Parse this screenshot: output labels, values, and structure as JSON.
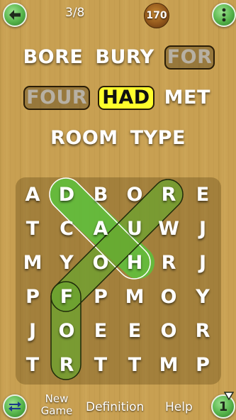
{
  "header": {
    "back_icon": "arrow-left-icon",
    "progress": "3/8",
    "score": "170",
    "menu_icon": "vertical-dots-icon"
  },
  "words": {
    "rows": [
      [
        {
          "text": "BORE",
          "state": "normal"
        },
        {
          "text": "BURY",
          "state": "normal"
        },
        {
          "text": "FOR",
          "state": "found"
        }
      ],
      [
        {
          "text": "FOUR",
          "state": "found"
        },
        {
          "text": "HAD",
          "state": "highlight"
        },
        {
          "text": "MET",
          "state": "normal"
        }
      ],
      [
        {
          "text": "ROOM",
          "state": "normal"
        },
        {
          "text": "TYPE",
          "state": "normal"
        }
      ]
    ]
  },
  "grid": {
    "letters": [
      [
        "A",
        "D",
        "B",
        "O",
        "R",
        "E"
      ],
      [
        "T",
        "C",
        "A",
        "U",
        "W",
        "J"
      ],
      [
        "M",
        "Y",
        "O",
        "H",
        "R",
        "J"
      ],
      [
        "P",
        "F",
        "P",
        "M",
        "O",
        "Y"
      ],
      [
        "J",
        "O",
        "E",
        "E",
        "O",
        "R"
      ],
      [
        "T",
        "R",
        "T",
        "T",
        "M",
        "P"
      ]
    ],
    "selections": [
      {
        "word": "HAD",
        "from": [
          2,
          3
        ],
        "to": [
          0,
          1
        ],
        "color": "#5fbf3c"
      },
      {
        "word": "FOR",
        "from": [
          3,
          1
        ],
        "to": [
          5,
          1
        ],
        "color": "#6aa52f"
      },
      {
        "word": "FOUR",
        "from": [
          3,
          1
        ],
        "to": [
          0,
          4
        ],
        "color": "#6aa52f"
      }
    ]
  },
  "bottom": {
    "switch_icon": "swap-arrows-icon",
    "new_game": "New Game",
    "definition": "Definition",
    "help": "Help",
    "hint_count": "1",
    "hint_icon": "hint-counter-icon"
  },
  "colors": {
    "button_green": "#55b34a",
    "highlight_yellow": "#ffff2c",
    "wood": "#c8a052"
  }
}
